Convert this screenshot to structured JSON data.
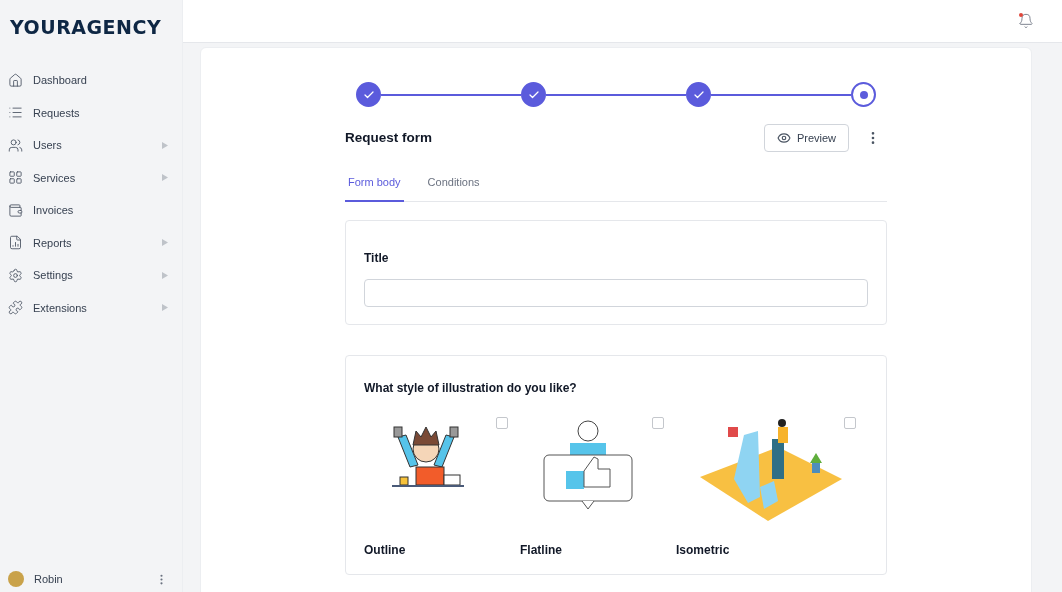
{
  "sidebar": {
    "logo": "YOURAGENCY",
    "items": [
      {
        "label": "Dashboard",
        "has_submenu": false
      },
      {
        "label": "Requests",
        "has_submenu": false
      },
      {
        "label": "Users",
        "has_submenu": true
      },
      {
        "label": "Services",
        "has_submenu": true
      },
      {
        "label": "Invoices",
        "has_submenu": false
      },
      {
        "label": "Reports",
        "has_submenu": true
      },
      {
        "label": "Settings",
        "has_submenu": true
      },
      {
        "label": "Extensions",
        "has_submenu": true
      }
    ],
    "user": {
      "name": "Robin"
    }
  },
  "header": {
    "has_notification": true
  },
  "stepper": [
    {
      "completed": true
    },
    {
      "completed": true
    },
    {
      "completed": true
    },
    {
      "completed": false
    }
  ],
  "form": {
    "title": "Request form",
    "preview_button": "Preview",
    "tabs": [
      {
        "label": "Form body",
        "selected": true
      },
      {
        "label": "Conditions",
        "selected": false
      }
    ],
    "title_field": {
      "label": "Title"
    },
    "question": {
      "label": "What style of illustration do you like?",
      "options": [
        {
          "label": "Outline",
          "checked": false
        },
        {
          "label": "Flatline",
          "checked": false
        },
        {
          "label": "Isometric",
          "checked": false
        }
      ]
    }
  }
}
